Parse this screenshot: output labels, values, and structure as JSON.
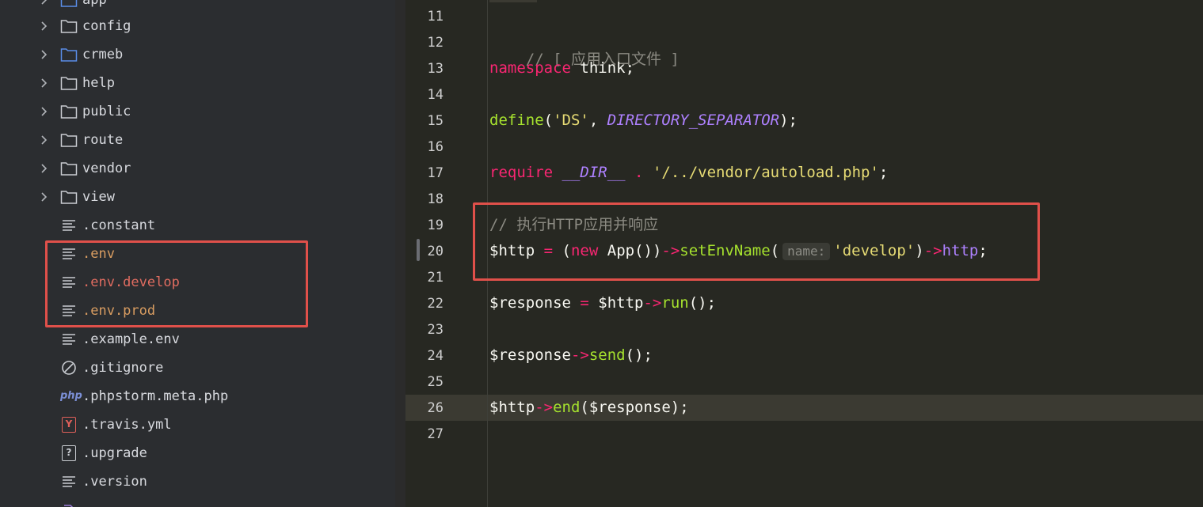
{
  "sidebar": {
    "items": [
      {
        "name": "app",
        "kind": "folder",
        "color": "default"
      },
      {
        "name": "config",
        "kind": "folder",
        "color": "default"
      },
      {
        "name": "crmeb",
        "kind": "folder-blue",
        "color": "default"
      },
      {
        "name": "help",
        "kind": "folder",
        "color": "default"
      },
      {
        "name": "public",
        "kind": "folder",
        "color": "default"
      },
      {
        "name": "route",
        "kind": "folder",
        "color": "default"
      },
      {
        "name": "vendor",
        "kind": "folder",
        "color": "default"
      },
      {
        "name": "view",
        "kind": "folder",
        "color": "default"
      },
      {
        "name": ".constant",
        "kind": "text-file",
        "color": "default"
      },
      {
        "name": ".env",
        "kind": "text-file",
        "color": "orange"
      },
      {
        "name": ".env.develop",
        "kind": "text-file",
        "color": "red"
      },
      {
        "name": ".env.prod",
        "kind": "text-file",
        "color": "orange"
      },
      {
        "name": ".example.env",
        "kind": "text-file",
        "color": "default"
      },
      {
        "name": ".gitignore",
        "kind": "ignore-file",
        "color": "default"
      },
      {
        "name": ".phpstorm.meta.php",
        "kind": "php-file",
        "color": "default"
      },
      {
        "name": ".travis.yml",
        "kind": "yaml-file",
        "color": "default"
      },
      {
        "name": ".upgrade",
        "kind": "unknown-file",
        "color": "default"
      },
      {
        "name": ".version",
        "kind": "text-file",
        "color": "default"
      }
    ],
    "php_badge": "php",
    "yaml_badge": "Y",
    "unknown_badge": "?"
  },
  "editor": {
    "line_numbers": [
      "11",
      "12",
      "13",
      "14",
      "15",
      "16",
      "17",
      "18",
      "19",
      "20",
      "21",
      "22",
      "23",
      "24",
      "25",
      "26",
      "27"
    ],
    "code": {
      "l12_comment": "// [ 应用入口文件 ]",
      "l13_kw": "namespace",
      "l13_rest": " think;",
      "l15_fn": "define",
      "l15_p1": "(",
      "l15_str": "'DS'",
      "l15_comma": ", ",
      "l15_const": "DIRECTORY_SEPARATOR",
      "l15_end": ");",
      "l17_kw": "require",
      "l17_sp": " ",
      "l17_const": "__DIR__",
      "l17_dot": " . ",
      "l17_str": "'/../vendor/autoload.php'",
      "l17_end": ";",
      "l19_comment": "// 执行HTTP应用并响应",
      "l20_var": "$http",
      "l20_eq": " = ",
      "l20_paren": "(",
      "l20_new": "new",
      "l20_app": " App())",
      "l20_arrow1": "->",
      "l20_method1": "setEnvName",
      "l20_p": "(",
      "l20_hint": "name:",
      "l20_str": "'develop'",
      "l20_close": ")",
      "l20_arrow2": "->",
      "l20_prop": "http",
      "l20_end": ";",
      "l22_var": "$response",
      "l22_eq": " = ",
      "l22_var2": "$http",
      "l22_arrow": "->",
      "l22_method": "run",
      "l22_end": "();",
      "l24_var": "$response",
      "l24_arrow": "->",
      "l24_method": "send",
      "l24_end": "();",
      "l26_var": "$http",
      "l26_arrow": "->",
      "l26_method": "end",
      "l26_end": "($response);"
    }
  },
  "colors": {
    "highlight_box": "#e0504a",
    "sidebar_bg": "#2b2d30",
    "editor_bg": "#272822"
  }
}
